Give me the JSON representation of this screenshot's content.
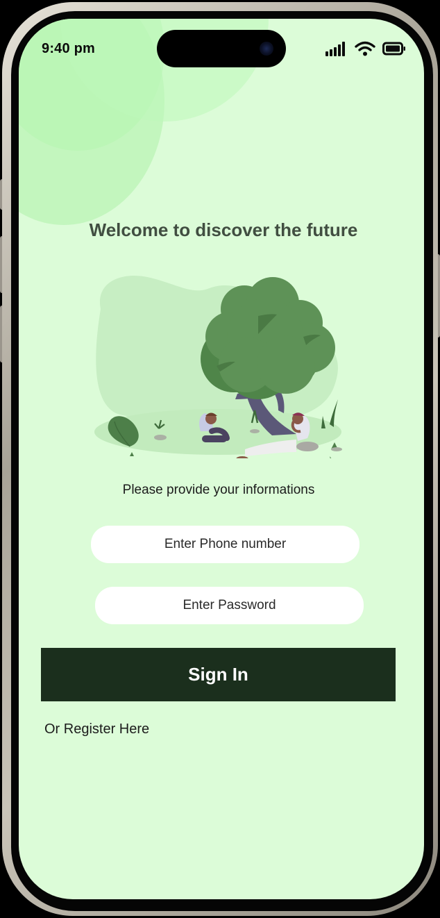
{
  "status_bar": {
    "time": "9:40 pm",
    "signal_icon": "cellular-signal-icon",
    "wifi_icon": "wifi-icon",
    "battery_icon": "battery-icon"
  },
  "main": {
    "title": "Welcome to discover the future",
    "illustration": "people-under-tree-illustration",
    "subtitle": "Please provide your informations",
    "phone_input": {
      "placeholder": "Enter Phone number",
      "value": ""
    },
    "password_input": {
      "placeholder": "Enter Password",
      "value": ""
    },
    "signin_label": "Sign In",
    "register_label": "Or Register Here"
  },
  "colors": {
    "background": "#dcfcd8",
    "title": "#414e41",
    "button_bg": "#1b2f1d",
    "button_text": "#ffffff",
    "input_bg": "#ffffff",
    "tree": "#5e9257"
  }
}
